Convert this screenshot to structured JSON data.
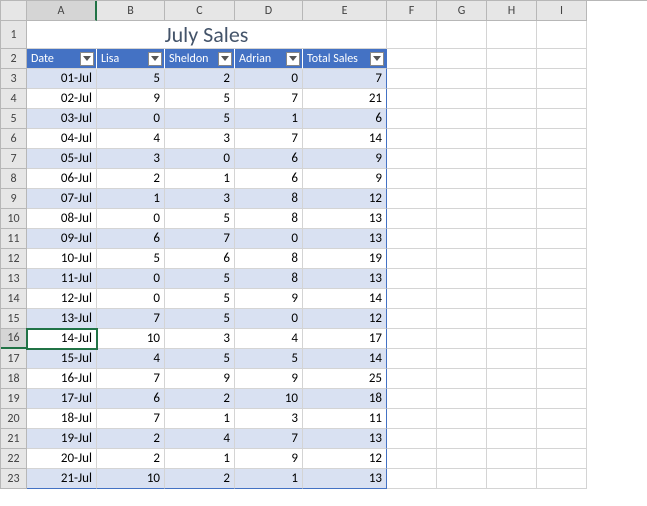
{
  "columns": [
    "A",
    "B",
    "C",
    "D",
    "E",
    "F",
    "G",
    "H",
    "I"
  ],
  "row_numbers": [
    1,
    2,
    3,
    4,
    5,
    6,
    7,
    8,
    9,
    10,
    11,
    12,
    13,
    14,
    15,
    16,
    17,
    18,
    19,
    20,
    21,
    22,
    23
  ],
  "title": "July Sales",
  "headers": [
    "Date",
    "Lisa",
    "Sheldon",
    "Adrian",
    "Total Sales"
  ],
  "active_cell": {
    "row": 16,
    "col": "A"
  },
  "chart_data": {
    "type": "table",
    "title": "July Sales",
    "columns": [
      "Date",
      "Lisa",
      "Sheldon",
      "Adrian",
      "Total Sales"
    ],
    "rows": [
      {
        "Date": "01-Jul",
        "Lisa": 5,
        "Sheldon": 2,
        "Adrian": 0,
        "Total Sales": 7
      },
      {
        "Date": "02-Jul",
        "Lisa": 9,
        "Sheldon": 5,
        "Adrian": 7,
        "Total Sales": 21
      },
      {
        "Date": "03-Jul",
        "Lisa": 0,
        "Sheldon": 5,
        "Adrian": 1,
        "Total Sales": 6
      },
      {
        "Date": "04-Jul",
        "Lisa": 4,
        "Sheldon": 3,
        "Adrian": 7,
        "Total Sales": 14
      },
      {
        "Date": "05-Jul",
        "Lisa": 3,
        "Sheldon": 0,
        "Adrian": 6,
        "Total Sales": 9
      },
      {
        "Date": "06-Jul",
        "Lisa": 2,
        "Sheldon": 1,
        "Adrian": 6,
        "Total Sales": 9
      },
      {
        "Date": "07-Jul",
        "Lisa": 1,
        "Sheldon": 3,
        "Adrian": 8,
        "Total Sales": 12
      },
      {
        "Date": "08-Jul",
        "Lisa": 0,
        "Sheldon": 5,
        "Adrian": 8,
        "Total Sales": 13
      },
      {
        "Date": "09-Jul",
        "Lisa": 6,
        "Sheldon": 7,
        "Adrian": 0,
        "Total Sales": 13
      },
      {
        "Date": "10-Jul",
        "Lisa": 5,
        "Sheldon": 6,
        "Adrian": 8,
        "Total Sales": 19
      },
      {
        "Date": "11-Jul",
        "Lisa": 0,
        "Sheldon": 5,
        "Adrian": 8,
        "Total Sales": 13
      },
      {
        "Date": "12-Jul",
        "Lisa": 0,
        "Sheldon": 5,
        "Adrian": 9,
        "Total Sales": 14
      },
      {
        "Date": "13-Jul",
        "Lisa": 7,
        "Sheldon": 5,
        "Adrian": 0,
        "Total Sales": 12
      },
      {
        "Date": "14-Jul",
        "Lisa": 10,
        "Sheldon": 3,
        "Adrian": 4,
        "Total Sales": 17
      },
      {
        "Date": "15-Jul",
        "Lisa": 4,
        "Sheldon": 5,
        "Adrian": 5,
        "Total Sales": 14
      },
      {
        "Date": "16-Jul",
        "Lisa": 7,
        "Sheldon": 9,
        "Adrian": 9,
        "Total Sales": 25
      },
      {
        "Date": "17-Jul",
        "Lisa": 6,
        "Sheldon": 2,
        "Adrian": 10,
        "Total Sales": 18
      },
      {
        "Date": "18-Jul",
        "Lisa": 7,
        "Sheldon": 1,
        "Adrian": 3,
        "Total Sales": 11
      },
      {
        "Date": "19-Jul",
        "Lisa": 2,
        "Sheldon": 4,
        "Adrian": 7,
        "Total Sales": 13
      },
      {
        "Date": "20-Jul",
        "Lisa": 2,
        "Sheldon": 1,
        "Adrian": 9,
        "Total Sales": 12
      },
      {
        "Date": "21-Jul",
        "Lisa": 10,
        "Sheldon": 2,
        "Adrian": 1,
        "Total Sales": 13
      }
    ]
  }
}
